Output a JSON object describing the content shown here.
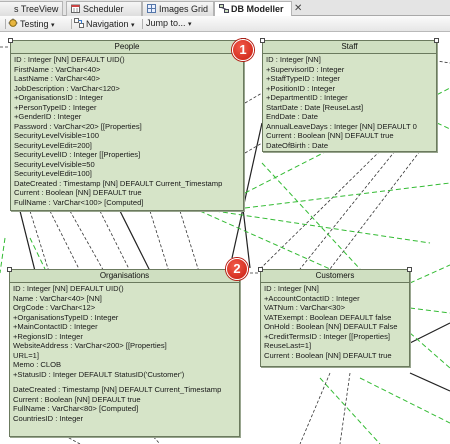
{
  "tabs": [
    {
      "label": "s TreeView",
      "icon": "tree-view-icon"
    },
    {
      "label": "Scheduler",
      "icon": "scheduler-icon"
    },
    {
      "label": "Images Grid",
      "icon": "images-grid-icon"
    },
    {
      "label": "DB Modeller",
      "icon": "db-modeller-icon",
      "active": true
    }
  ],
  "toolbar": {
    "testing_label": "Testing",
    "navigation_label": "Navigation",
    "jump_label": "Jump to..."
  },
  "entities": {
    "people": {
      "name": "People",
      "fields": [
        "ID : Integer [NN] DEFAULT UID()",
        "FirstName : VarChar<40>",
        "LastName : VarChar<40>",
        "JobDescription : VarChar<120>",
        "+OrganisationsID : Integer",
        "+PersonTypeID : Integer",
        "+GenderID : Integer",
        "Password : VarChar<20> [[Properties]",
        "SecurityLevelVisible=100",
        "SecurityLevelEdit=200]",
        "SecurityLevelID : Integer [[Properties]",
        "SecurityLevelVisible=50",
        "SecurityLevelEdit=100]",
        "DateCreated : Timestamp [NN] DEFAULT Current_Timestamp",
        "Current : Boolean [NN] DEFAULT true",
        "FullName : VarChar<100> [Computed]"
      ]
    },
    "staff": {
      "name": "Staff",
      "fields": [
        "ID : Integer [NN]",
        "+SupervisorID : Integer",
        "+StaffTypeID : Integer",
        "+PositionID : Integer",
        "+DepartmentID : Integer",
        "StartDate : Date [ReuseLast]",
        "EndDate : Date",
        "AnnualLeaveDays : Integer [NN] DEFAULT 0",
        "Current : Boolean [NN] DEFAULT true",
        "DateOfBirth : Date"
      ]
    },
    "organisations": {
      "name": "Organisations",
      "fields": [
        "ID : Integer [NN] DEFAULT UID()",
        "Name : VarChar<40> [NN]",
        "OrgCode : VarChar<12>",
        "+OrganisationsTypeID : Integer",
        "+MainContactID : Integer",
        "+RegionsID : Integer",
        "WebsiteAddress : VarChar<200> [[Properties]",
        "URL=1]",
        "Memo : CLOB",
        "+StatusID : Integer DEFAULT StatusID('Customer')",
        "DateCreated : Timestamp [NN] DEFAULT Current_Timestamp",
        "Current : Boolean [NN] DEFAULT true",
        "FullName : VarChar<80> [Computed]",
        "CountriesID : Integer"
      ]
    },
    "customers": {
      "name": "Customers",
      "fields": [
        "ID : Integer [NN]",
        "+AccountContactID : Integer",
        "VATNum : VarChar<30>",
        "VATExempt : Boolean DEFAULT false",
        "OnHold : Boolean [NN] DEFAULT False",
        "+CreditTermsID : Integer [[Properties]",
        "ReuseLast=1]",
        "Current : Boolean [NN] DEFAULT true"
      ]
    }
  },
  "badges": [
    "1",
    "2"
  ],
  "colors": {
    "entity_fill": "#d6e4c8",
    "entity_border": "#6b7a5e",
    "relation_green": "#33bb33",
    "relation_dark": "#333333",
    "badge_red": "#d8281a"
  }
}
